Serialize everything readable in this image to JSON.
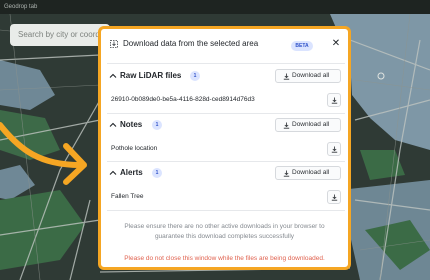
{
  "app": {
    "title": "Geodrop tab"
  },
  "search": {
    "placeholder": "Search by city or coord"
  },
  "map": {
    "colors": {
      "water": "#7e97a6",
      "land": "#2f3a35",
      "park": "#3b6b46",
      "road": "#bfc5c1"
    }
  },
  "accent": "#f5a623",
  "dialog": {
    "title": "Download data from the selected area",
    "badge": "BETA",
    "close_icon": "close-icon",
    "sections": [
      {
        "title": "Raw LiDAR files",
        "count": "1",
        "download_all": "Download all",
        "items": [
          "26910-0b089de0-be5a-4116-828d-ced8914d76d3"
        ]
      },
      {
        "title": "Notes",
        "count": "1",
        "download_all": "Download all",
        "items": [
          "Pothole location"
        ]
      },
      {
        "title": "Alerts",
        "count": "1",
        "download_all": "Download all",
        "items": [
          "Fallen Tree"
        ]
      }
    ],
    "notice_line1": "Please ensure there are no other active downloads in your browser to",
    "notice_line2": "guarantee this download completes successfully",
    "warning": "Please do not close this window while the files are being downloaded."
  }
}
